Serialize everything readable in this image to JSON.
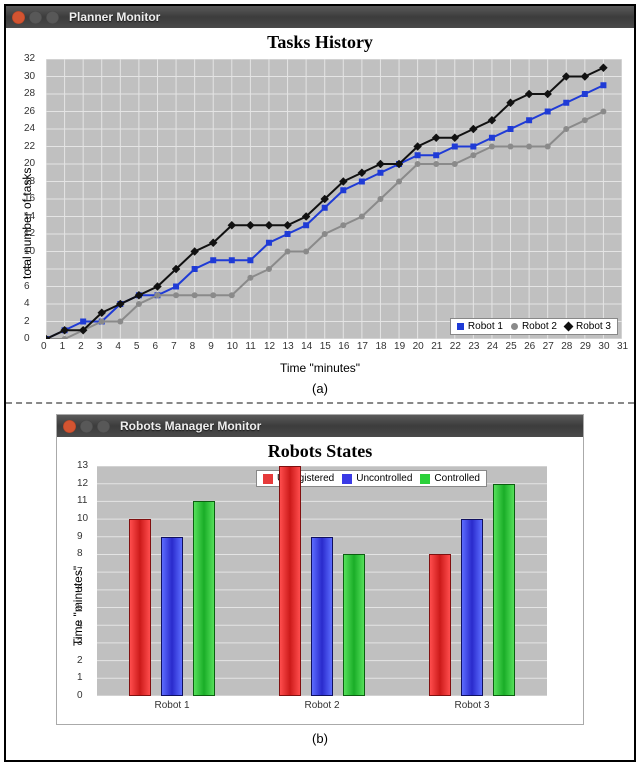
{
  "top_window": {
    "title": "Planner Monitor",
    "chart_title": "Tasks History",
    "xlabel": "Time \"minutes\"",
    "ylabel": "total number of tasks"
  },
  "bottom_window": {
    "title": "Robots Manager Monitor",
    "chart_title": "Robots States",
    "xlabel": "",
    "ylabel": "Time \"minutes\""
  },
  "sublabels": {
    "a": "(a)",
    "b": "(b)"
  },
  "legend_top": {
    "r1": "Robot 1",
    "r2": "Robot 2",
    "r3": "Robot 3"
  },
  "legend_bottom": {
    "s1": "Unregistered",
    "s2": "Uncontrolled",
    "s3": "Controlled"
  },
  "bottom_cats": {
    "c1": "Robot 1",
    "c2": "Robot 2",
    "c3": "Robot 3"
  },
  "chart_data": [
    {
      "type": "line",
      "title": "Tasks History",
      "xlabel": "Time \"minutes\"",
      "ylabel": "total number of tasks",
      "xlim": [
        0,
        31
      ],
      "ylim": [
        0,
        32
      ],
      "xticks": [
        0,
        1,
        2,
        3,
        4,
        5,
        6,
        7,
        8,
        9,
        10,
        11,
        12,
        13,
        14,
        15,
        16,
        17,
        18,
        19,
        20,
        21,
        22,
        23,
        24,
        25,
        26,
        27,
        28,
        29,
        30,
        31
      ],
      "yticks": [
        0,
        2,
        4,
        6,
        8,
        10,
        12,
        14,
        16,
        18,
        20,
        22,
        24,
        26,
        28,
        30,
        32
      ],
      "x": [
        0,
        1,
        2,
        3,
        4,
        5,
        6,
        7,
        8,
        9,
        10,
        11,
        12,
        13,
        14,
        15,
        16,
        17,
        18,
        19,
        20,
        21,
        22,
        23,
        24,
        25,
        26,
        27,
        28,
        29,
        30
      ],
      "series": [
        {
          "name": "Robot 1",
          "color": "#1f3bd6",
          "values": [
            0,
            1,
            2,
            2,
            4,
            5,
            5,
            6,
            8,
            9,
            9,
            9,
            11,
            12,
            13,
            15,
            17,
            18,
            19,
            20,
            21,
            21,
            22,
            22,
            23,
            24,
            25,
            26,
            27,
            28,
            29
          ]
        },
        {
          "name": "Robot 2",
          "color": "#8a8a8a",
          "values": [
            0,
            0,
            1,
            2,
            2,
            4,
            5,
            5,
            5,
            5,
            5,
            7,
            8,
            10,
            10,
            12,
            13,
            14,
            16,
            18,
            20,
            20,
            20,
            21,
            22,
            22,
            22,
            22,
            24,
            25,
            26
          ]
        },
        {
          "name": "Robot 3",
          "color": "#111111",
          "values": [
            0,
            1,
            1,
            3,
            4,
            5,
            6,
            8,
            10,
            11,
            13,
            13,
            13,
            13,
            14,
            16,
            18,
            19,
            20,
            20,
            22,
            23,
            23,
            24,
            25,
            27,
            28,
            28,
            30,
            30,
            31
          ]
        }
      ],
      "legend_position": "bottom-right",
      "grid": true
    },
    {
      "type": "bar",
      "title": "Robots States",
      "xlabel": "",
      "ylabel": "Time \"minutes\"",
      "ylim": [
        0,
        13
      ],
      "yticks": [
        0,
        1,
        2,
        3,
        4,
        5,
        6,
        7,
        8,
        9,
        10,
        11,
        12,
        13
      ],
      "categories": [
        "Robot 1",
        "Robot 2",
        "Robot 3"
      ],
      "series": [
        {
          "name": "Unregistered",
          "color": "#e63a3a",
          "values": [
            10,
            13,
            8
          ]
        },
        {
          "name": "Uncontrolled",
          "color": "#3a3ae6",
          "values": [
            9,
            9,
            10
          ]
        },
        {
          "name": "Controlled",
          "color": "#2bd13a",
          "values": [
            11,
            8,
            12
          ]
        }
      ],
      "legend_position": "top-right",
      "grid": true
    }
  ]
}
